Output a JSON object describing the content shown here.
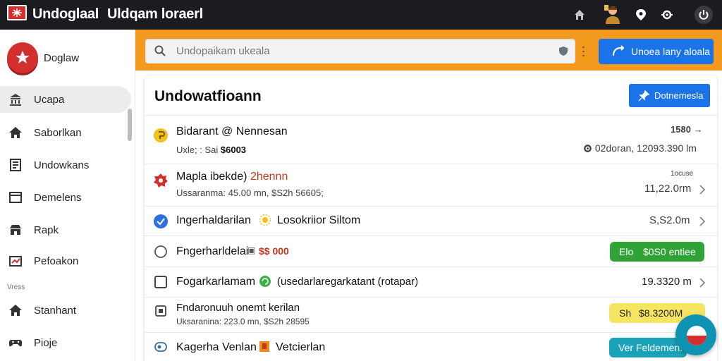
{
  "app": {
    "brand_name": "Undoglaal",
    "brand_sub": "Uldqam loraerl"
  },
  "topbar": {
    "icons": [
      "home-icon",
      "avatar-icon",
      "location-pin-icon",
      "settings-icon",
      "power-icon"
    ]
  },
  "sidebar": {
    "title": "Doglaw",
    "items": [
      {
        "label": "Ucapa",
        "icon": "bank-icon",
        "active": true
      },
      {
        "label": "Saborlkan",
        "icon": "home-icon",
        "active": false
      },
      {
        "label": "Undowkans",
        "icon": "document-icon",
        "active": false
      },
      {
        "label": "Demelens",
        "icon": "window-icon",
        "active": false
      },
      {
        "label": "Rapk",
        "icon": "store-icon",
        "active": false
      },
      {
        "label": "Pefoakon",
        "icon": "analytics-icon",
        "active": false
      }
    ],
    "section_label": "Vress",
    "items2": [
      {
        "label": "Stanhant",
        "icon": "home-icon"
      },
      {
        "label": "Pioje",
        "icon": "gamepad-icon"
      }
    ]
  },
  "search": {
    "placeholder": "Undopaikam ukeala"
  },
  "band_button": {
    "label": "Unoea lany aloala"
  },
  "card": {
    "title": "Undowatfioann",
    "button_label": "Dotnemesla",
    "rows": [
      {
        "icon": "coin-icon",
        "main": "Bidarant @ Nennesan",
        "sub_prefix": "Uxle; : Sai",
        "sub_bold": "$6003",
        "value_top": "1580",
        "value_bottom": "02doran, 12093.390 lm",
        "value_icon": "gear-icon"
      },
      {
        "icon": "badge-icon",
        "main_prefix": "Mapla ibekde)",
        "main_highlight": "2hennn",
        "sub": "Ussaranma: 45.00 mn, $S2h 56605;",
        "value_top": "1ocuse",
        "value_bottom": "11,22.0rm"
      },
      {
        "icon": "check-circle-icon",
        "link1": "Ingerhaldarilan",
        "tag_icon": "sun-icon",
        "link2": "Losokriior Siltom",
        "value": "S,S2.0m"
      },
      {
        "icon": "radio-icon",
        "link1": "Fngerharldelai",
        "tag_icon": "lock-icon",
        "amount": "$$ 000",
        "pill_left": "Elo",
        "pill_right": "$0S0 entiee"
      },
      {
        "icon": "checkbox-icon",
        "link1": "Fogarkarlamam",
        "tag_icon": "recycle-icon",
        "link2": "(usedarlaregarkatant (rotapar)",
        "value": "19.3320 m"
      },
      {
        "icon": "pen-box-icon",
        "main": "Fndaronuuh onemt kerilan",
        "sub": "Uksaranina: 223.0 mn, $S2h 28595",
        "pill_left": "Sh",
        "pill_right": "$8.3200M"
      },
      {
        "icon": "toggle-icon",
        "link1": "Kagerha Venlan",
        "tag_icon": "book-icon",
        "link2": "Vetcierlan",
        "pill_label": "Ver Feldemen."
      }
    ]
  },
  "colors": {
    "topbar": "#1b1c1f",
    "band": "#f39a1e",
    "primary": "#1a73e8",
    "green": "#2e9b2e",
    "yellow": "#f7e463",
    "teal": "#1aa3b8",
    "brand_red": "#d32f2f"
  }
}
